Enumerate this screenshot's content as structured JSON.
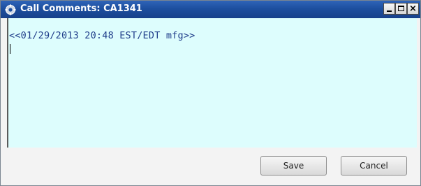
{
  "window": {
    "title": "Call Comments: CA1341",
    "icon": "phone-gear-icon",
    "controls": {
      "minimize": "minimize-icon",
      "maximize": "maximize-icon",
      "close_label": "×"
    }
  },
  "editor": {
    "text": "<<01/29/2013 20:48 EST/EDT mfg>>",
    "background": "#ddfdfd",
    "text_color": "#1f3d8a"
  },
  "footer": {
    "save_label": "Save",
    "cancel_label": "Cancel"
  },
  "colors": {
    "titlebar": "#1d4f9f"
  }
}
